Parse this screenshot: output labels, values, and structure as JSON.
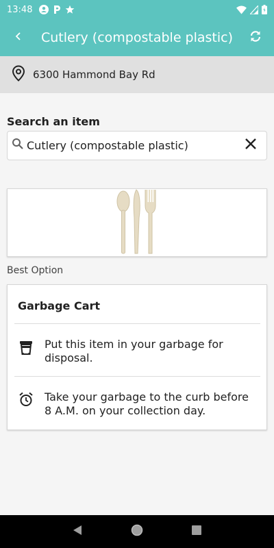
{
  "status_bar": {
    "time": "13:48",
    "left_icons": [
      "account-circle-icon",
      "parking-icon",
      "star-icon"
    ],
    "right_icons": [
      "wifi-icon",
      "signal-icon",
      "battery-icon"
    ]
  },
  "app_bar": {
    "title": "Cutlery (compostable plastic)",
    "back_icon": "back-arrow-icon",
    "refresh_icon": "refresh-icon"
  },
  "address": {
    "text": "6300 Hammond Bay Rd",
    "icon": "location-pin-icon"
  },
  "search": {
    "label": "Search an item",
    "value": "Cutlery (compostable plastic)"
  },
  "best_option": {
    "label": "Best Option",
    "title": "Garbage Cart",
    "instructions": [
      {
        "icon": "garbage-bin-icon",
        "text": "Put this item in your garbage for disposal."
      },
      {
        "icon": "alarm-clock-icon",
        "text": "Take your garbage to the curb before 8 A.M. on your collection day."
      }
    ]
  },
  "colors": {
    "accent": "#5cc4bf",
    "address_bg": "#e0e0e0",
    "page_bg": "#f5f5f5"
  }
}
